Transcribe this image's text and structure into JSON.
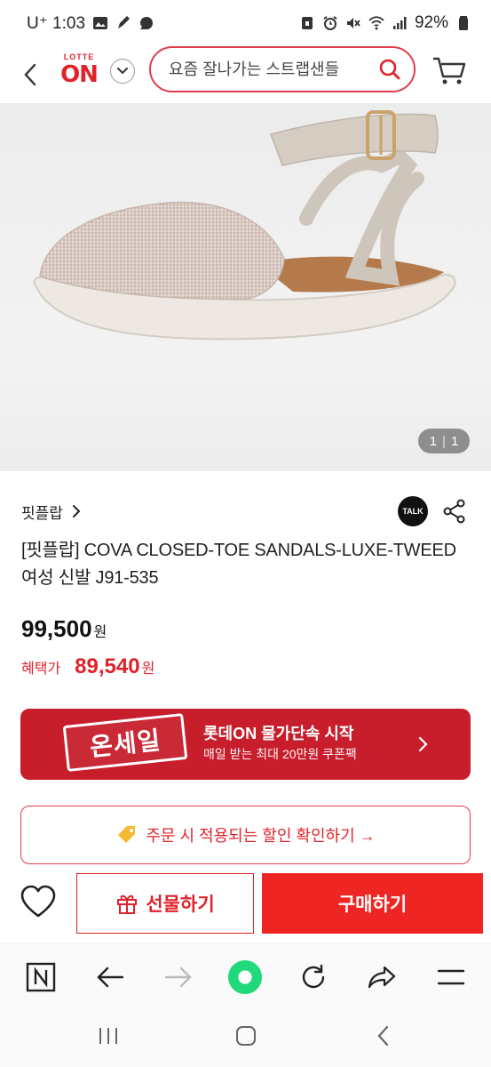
{
  "status_bar": {
    "carrier_time": "U⁺ 1:03",
    "battery": "92%"
  },
  "header": {
    "logo_top": "LOTTE",
    "logo_main": "ON",
    "search_placeholder": "요즘 잘나가는 스트랩샌들"
  },
  "product_image": {
    "counter_current": "1",
    "counter_total": "1"
  },
  "brand": {
    "name": "핏플랍",
    "talk_label": "TALK"
  },
  "product": {
    "title": "[핏플랍] COVA CLOSED-TOE SANDALS-LUXE-TWEED 여성 신발 J91-535",
    "price": "99,500",
    "currency": "원",
    "benefit_label": "혜택가",
    "benefit_price": "89,540",
    "benefit_currency": "원"
  },
  "promo": {
    "stamp": "온세일",
    "title": "롯데ON 물가단속 시작",
    "subtitle": "매일 받는 최대 20만원 쿠폰팩"
  },
  "coupon_info": {
    "text": "주문 시 적용되는 할인 확인하기 →"
  },
  "actions": {
    "gift_label": "선물하기",
    "buy_label": "구매하기"
  },
  "colors": {
    "brand_red": "#e0222b",
    "promo_red": "#c81e2c",
    "buy_red": "#ee2523",
    "browser_green": "#1fd97a"
  }
}
